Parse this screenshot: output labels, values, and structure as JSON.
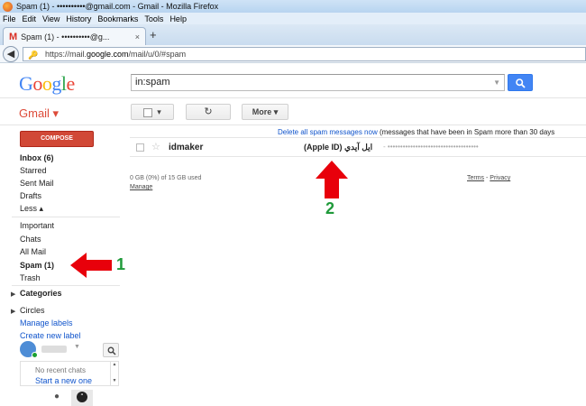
{
  "window": {
    "title": "Spam (1) - ••••••••••@gmail.com - Gmail - Mozilla Firefox"
  },
  "menubar": [
    "File",
    "Edit",
    "View",
    "History",
    "Bookmarks",
    "Tools",
    "Help"
  ],
  "tab": {
    "title": "Spam (1) - ••••••••••@g...",
    "close": "×"
  },
  "newtab": "+",
  "url": {
    "prefix": "https://mail.",
    "host": "google.com",
    "path": "/mail/u/0/#spam"
  },
  "google_logo": {
    "letters": [
      "G",
      "o",
      "o",
      "g",
      "l",
      "e"
    ],
    "colors": [
      "#4285f4",
      "#ea4335",
      "#fbbc05",
      "#4285f4",
      "#34a853",
      "#ea4335"
    ]
  },
  "search": {
    "value": "in:spam"
  },
  "gmail_menu": "Gmail ▾",
  "toolbar": {
    "refresh": "↻",
    "more": "More ▾"
  },
  "compose": "COMPOSE",
  "nav": {
    "inbox": "Inbox (6)",
    "starred": "Starred",
    "sent": "Sent Mail",
    "drafts": "Drafts",
    "less": "Less ▴",
    "important": "Important",
    "chats": "Chats",
    "allmail": "All Mail",
    "spam": "Spam (1)",
    "trash": "Trash",
    "categories": "Categories",
    "circles": "Circles",
    "manage_labels": "Manage labels",
    "create_label": "Create new label"
  },
  "banner": {
    "link": "Delete all spam messages now",
    "text": " (messages that have been in Spam more than 30 days"
  },
  "message": {
    "sender": "idmaker",
    "subject": "(Apple ID) ايل آيدي",
    "snippet": "- ••••••••••••••••••••••••••••••••••••"
  },
  "footer": {
    "storage": "0 GB (0%) of 15 GB used",
    "manage": "Manage",
    "terms": "Terms",
    "dash": " - ",
    "privacy": "Privacy"
  },
  "chat": {
    "no_recent": "No recent chats",
    "start_new": "Start a new one"
  },
  "annotations": {
    "arrow1_label": "1",
    "arrow2_label": "2",
    "arrow_color": "#e8000b"
  }
}
